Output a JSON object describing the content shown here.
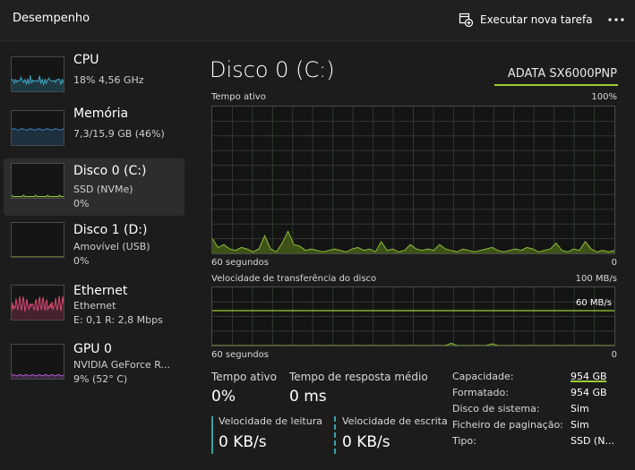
{
  "header": {
    "title": "Desempenho",
    "new_task_label": "Executar nova tarefa",
    "new_task_icon": "new-task-icon",
    "more_icon": "more-options-icon"
  },
  "sidebar": {
    "items": [
      {
        "name": "CPU",
        "line1": "18% 4,56 GHz",
        "line2": "",
        "color": "#3fa9c9"
      },
      {
        "name": "Memória",
        "line1": "7,3/15,9 GB (46%)",
        "line2": "",
        "color": "#3c7fc1"
      },
      {
        "name": "Disco 0 (C:)",
        "line1": "SSD (NVMe)",
        "line2": "0%",
        "color": "#8fbe3a"
      },
      {
        "name": "Disco 1 (D:)",
        "line1": "Amovível (USB)",
        "line2": "0%",
        "color": "#8fbe3a"
      },
      {
        "name": "Ethernet",
        "line1": "Ethernet",
        "line2": "E: 0,1 R: 2,8 Mbps",
        "color": "#d64a72"
      },
      {
        "name": "GPU 0",
        "line1": "NVIDIA GeForce R...",
        "line2": "9% (52° C)",
        "color": "#b05fc9"
      }
    ]
  },
  "main": {
    "title": "Disco 0 (C:)",
    "model": "ADATA SX6000PNP",
    "active_graph": {
      "label": "Tempo ativo",
      "max": "100%",
      "time": "60 segundos",
      "min": "0",
      "values": [
        10,
        4,
        6,
        3,
        2,
        4,
        3,
        1,
        3,
        12,
        3,
        1,
        7,
        15,
        6,
        5,
        2,
        3,
        2,
        1,
        2,
        3,
        2,
        1,
        3,
        4,
        2,
        3,
        1,
        8,
        2,
        3,
        1,
        2,
        6,
        3,
        2,
        3,
        2,
        6,
        3,
        2,
        1,
        3,
        2,
        1,
        2,
        3,
        4,
        2,
        1,
        2,
        3,
        2,
        4,
        3,
        1,
        2,
        3,
        7,
        2,
        1,
        3,
        2,
        8,
        3,
        1,
        2,
        1,
        2
      ]
    },
    "transfer_graph": {
      "label": "Velocidade de transferência do disco",
      "max": "100 MB/s",
      "ref_label": "60 MB/s",
      "ref_value": 60,
      "time": "60 segundos",
      "min": "0",
      "values": [
        0,
        0,
        0,
        0,
        0,
        0,
        0,
        0,
        0,
        0,
        0,
        0,
        0,
        0,
        0,
        0,
        0,
        0,
        0,
        0,
        0,
        0,
        0,
        0,
        0,
        0,
        0,
        0,
        0,
        0,
        0,
        0,
        0,
        0,
        0,
        0,
        0,
        0,
        0,
        0,
        0,
        4,
        0,
        0,
        0,
        0,
        0,
        0,
        3,
        0,
        0,
        0,
        0,
        0,
        0,
        0,
        0,
        0,
        0,
        0,
        0,
        0,
        0,
        0,
        0,
        0,
        0,
        0,
        0,
        0
      ]
    },
    "stats": {
      "active_time_label": "Tempo ativo",
      "active_time_value": "0%",
      "response_label": "Tempo de resposta médio",
      "response_value": "0 ms",
      "read_label": "Velocidade de leitura",
      "read_value": "0 KB/s",
      "write_label": "Velocidade de escrita",
      "write_value": "0 KB/s"
    },
    "properties": [
      {
        "label": "Capacidade:",
        "value": "954 GB"
      },
      {
        "label": "Formatado:",
        "value": "954 GB"
      },
      {
        "label": "Disco de sistema:",
        "value": "Sim"
      },
      {
        "label": "Ficheiro de paginação:",
        "value": "Sim"
      },
      {
        "label": "Tipo:",
        "value": "SSD (N..."
      }
    ]
  },
  "colors": {
    "disk": "#8fbe3a",
    "disk_fill": "#3d5216",
    "grid": "#2f3a2f",
    "reference_line": "#9acd32"
  }
}
